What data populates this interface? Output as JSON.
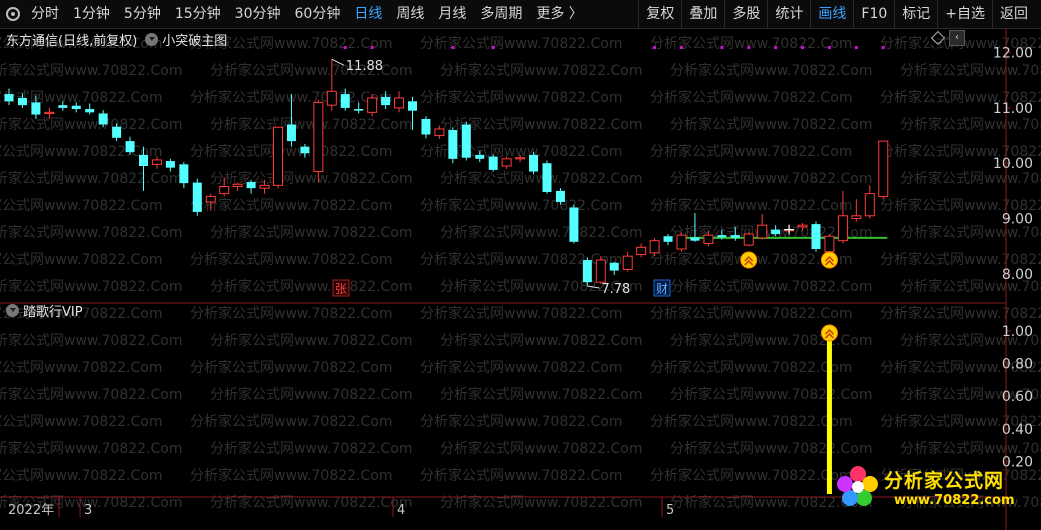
{
  "toolbar": {
    "periods": [
      "分时",
      "1分钟",
      "5分钟",
      "15分钟",
      "30分钟",
      "60分钟",
      "日线",
      "周线",
      "月线",
      "多周期",
      "更多 〉"
    ],
    "active_period": "日线",
    "actions": [
      "复权",
      "叠加",
      "多股",
      "统计",
      "画线",
      "F10",
      "标记",
      "+自选",
      "返回"
    ],
    "active_action": "画线"
  },
  "main_panel": {
    "title": "东方通信(日线,前复权)",
    "indicator": "小突破主图",
    "high_label": "11.88",
    "low_label": "7.78",
    "zhang_label": "张",
    "cai_label": "财"
  },
  "sub_panel": {
    "indicator": "踏歌行VIP"
  },
  "logo": {
    "line1": "分析家公式网",
    "line2": "www.70822.com"
  },
  "watermark": "分析家公式网www.70822.Com",
  "time_axis": {
    "year": "2022年",
    "months": [
      "3",
      "4",
      "5"
    ]
  },
  "colors": {
    "up": "#ff3b3b",
    "down": "#54ffff",
    "ma": "#2fbf2f",
    "signal": "#ffd000",
    "bar": "#ffff00",
    "marker": "#d010d0"
  },
  "chart_data": [
    {
      "type": "candlestick",
      "title": "东方通信(日线,前复权)",
      "y_ticks": [
        12.0,
        11.0,
        10.0,
        9.0,
        8.0
      ],
      "ylim": [
        7.6,
        12.3
      ],
      "candles": [
        {
          "o": 11.25,
          "h": 11.35,
          "l": 11.05,
          "c": 11.12
        },
        {
          "o": 11.18,
          "h": 11.26,
          "l": 11.0,
          "c": 11.05
        },
        {
          "o": 11.1,
          "h": 11.22,
          "l": 10.8,
          "c": 10.88
        },
        {
          "o": 10.9,
          "h": 11.0,
          "l": 10.8,
          "c": 10.92
        },
        {
          "o": 11.05,
          "h": 11.12,
          "l": 10.95,
          "c": 11.0
        },
        {
          "o": 11.04,
          "h": 11.1,
          "l": 10.92,
          "c": 10.98
        },
        {
          "o": 10.98,
          "h": 11.08,
          "l": 10.88,
          "c": 10.92
        },
        {
          "o": 10.9,
          "h": 10.96,
          "l": 10.65,
          "c": 10.7
        },
        {
          "o": 10.66,
          "h": 10.72,
          "l": 10.4,
          "c": 10.46
        },
        {
          "o": 10.4,
          "h": 10.48,
          "l": 10.15,
          "c": 10.2
        },
        {
          "o": 10.15,
          "h": 10.3,
          "l": 9.5,
          "c": 9.95
        },
        {
          "o": 9.98,
          "h": 10.12,
          "l": 9.9,
          "c": 10.06
        },
        {
          "o": 10.04,
          "h": 10.08,
          "l": 9.85,
          "c": 9.92
        },
        {
          "o": 9.98,
          "h": 10.02,
          "l": 9.55,
          "c": 9.64
        },
        {
          "o": 9.65,
          "h": 9.72,
          "l": 9.05,
          "c": 9.12
        },
        {
          "o": 9.3,
          "h": 9.45,
          "l": 9.15,
          "c": 9.4
        },
        {
          "o": 9.45,
          "h": 9.75,
          "l": 9.4,
          "c": 9.58
        },
        {
          "o": 9.58,
          "h": 9.65,
          "l": 9.5,
          "c": 9.62
        },
        {
          "o": 9.66,
          "h": 9.7,
          "l": 9.45,
          "c": 9.55
        },
        {
          "o": 9.55,
          "h": 9.7,
          "l": 9.45,
          "c": 9.6
        },
        {
          "o": 9.6,
          "h": 10.0,
          "l": 9.55,
          "c": 10.65
        },
        {
          "o": 10.7,
          "h": 11.25,
          "l": 10.3,
          "c": 10.4
        },
        {
          "o": 10.3,
          "h": 10.35,
          "l": 10.1,
          "c": 10.18
        },
        {
          "o": 9.85,
          "h": 11.15,
          "l": 9.65,
          "c": 11.1
        },
        {
          "o": 11.05,
          "h": 11.88,
          "l": 10.95,
          "c": 11.3
        },
        {
          "o": 11.25,
          "h": 11.35,
          "l": 10.95,
          "c": 11.0
        },
        {
          "o": 10.98,
          "h": 11.1,
          "l": 10.9,
          "c": 10.95
        },
        {
          "o": 10.92,
          "h": 11.25,
          "l": 10.85,
          "c": 11.18
        },
        {
          "o": 11.2,
          "h": 11.3,
          "l": 10.98,
          "c": 11.05
        },
        {
          "o": 11.0,
          "h": 11.3,
          "l": 10.92,
          "c": 11.18
        },
        {
          "o": 11.12,
          "h": 11.2,
          "l": 10.6,
          "c": 10.95
        },
        {
          "o": 10.8,
          "h": 10.85,
          "l": 10.45,
          "c": 10.52
        },
        {
          "o": 10.5,
          "h": 10.68,
          "l": 10.44,
          "c": 10.62
        },
        {
          "o": 10.6,
          "h": 10.65,
          "l": 10.0,
          "c": 10.08
        },
        {
          "o": 10.7,
          "h": 10.75,
          "l": 10.05,
          "c": 10.1
        },
        {
          "o": 10.15,
          "h": 10.22,
          "l": 10.02,
          "c": 10.08
        },
        {
          "o": 10.12,
          "h": 10.16,
          "l": 9.85,
          "c": 9.88
        },
        {
          "o": 9.95,
          "h": 10.12,
          "l": 9.9,
          "c": 10.08
        },
        {
          "o": 10.08,
          "h": 10.15,
          "l": 10.02,
          "c": 10.1
        },
        {
          "o": 10.15,
          "h": 10.2,
          "l": 9.8,
          "c": 9.85
        },
        {
          "o": 10.0,
          "h": 10.05,
          "l": 9.45,
          "c": 9.48
        },
        {
          "o": 9.5,
          "h": 9.55,
          "l": 9.25,
          "c": 9.3
        },
        {
          "o": 9.2,
          "h": 9.25,
          "l": 8.55,
          "c": 8.58
        },
        {
          "o": 8.25,
          "h": 8.3,
          "l": 7.78,
          "c": 7.85
        },
        {
          "o": 7.85,
          "h": 8.32,
          "l": 7.82,
          "c": 8.25
        },
        {
          "o": 8.2,
          "h": 8.22,
          "l": 7.98,
          "c": 8.06
        },
        {
          "o": 8.08,
          "h": 8.4,
          "l": 8.04,
          "c": 8.32
        },
        {
          "o": 8.35,
          "h": 8.55,
          "l": 8.3,
          "c": 8.48
        },
        {
          "o": 8.38,
          "h": 8.65,
          "l": 8.32,
          "c": 8.6
        },
        {
          "o": 8.68,
          "h": 8.72,
          "l": 8.52,
          "c": 8.58
        },
        {
          "o": 8.45,
          "h": 8.75,
          "l": 8.4,
          "c": 8.7
        },
        {
          "o": 8.66,
          "h": 9.1,
          "l": 8.58,
          "c": 8.6
        },
        {
          "o": 8.55,
          "h": 8.78,
          "l": 8.5,
          "c": 8.7
        },
        {
          "o": 8.7,
          "h": 8.8,
          "l": 8.62,
          "c": 8.66
        },
        {
          "o": 8.7,
          "h": 8.85,
          "l": 8.6,
          "c": 8.65
        },
        {
          "o": 8.52,
          "h": 8.75,
          "l": 8.5,
          "c": 8.72
        },
        {
          "o": 8.65,
          "h": 9.08,
          "l": 8.62,
          "c": 8.88
        },
        {
          "o": 8.8,
          "h": 8.88,
          "l": 8.68,
          "c": 8.72
        },
        {
          "o": 8.8,
          "h": 8.88,
          "l": 8.75,
          "c": 8.8
        },
        {
          "o": 8.85,
          "h": 8.92,
          "l": 8.78,
          "c": 8.88
        },
        {
          "o": 8.9,
          "h": 8.95,
          "l": 8.4,
          "c": 8.45
        },
        {
          "o": 8.4,
          "h": 8.72,
          "l": 8.38,
          "c": 8.68
        },
        {
          "o": 8.6,
          "h": 9.5,
          "l": 8.55,
          "c": 9.05
        },
        {
          "o": 9.0,
          "h": 9.35,
          "l": 8.95,
          "c": 9.05
        },
        {
          "o": 9.05,
          "h": 9.6,
          "l": 9.0,
          "c": 9.45
        },
        {
          "o": 9.4,
          "h": 10.4,
          "l": 9.35,
          "c": 10.4
        }
      ],
      "ma_line": {
        "from_index": 50,
        "to_index": 65,
        "value": 8.65
      },
      "signal_indices": [
        55,
        61
      ]
    },
    {
      "type": "bar",
      "title": "踏歌行VIP",
      "y_ticks": [
        1.0,
        0.8,
        0.6,
        0.4,
        0.2
      ],
      "ylim": [
        0,
        1.08
      ],
      "bars": [
        {
          "index": 61,
          "value": 1.0
        }
      ]
    }
  ]
}
